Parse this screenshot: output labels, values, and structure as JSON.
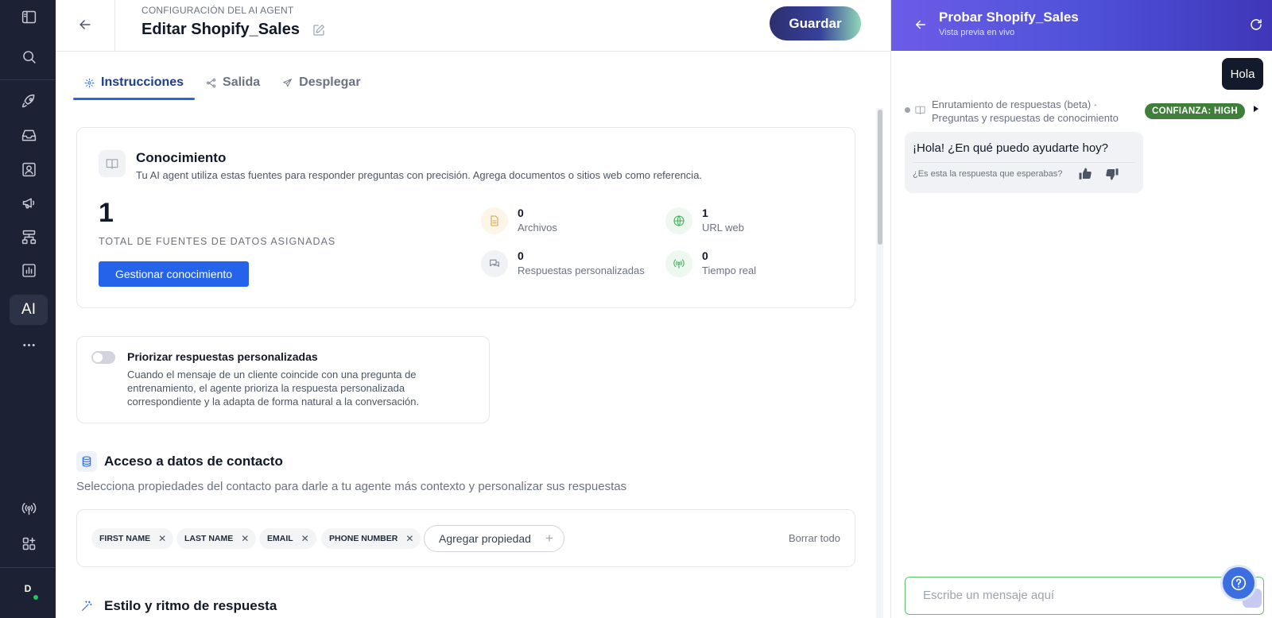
{
  "header": {
    "eyebrow": "CONFIGURACIÓN DEL AI AGENT",
    "title": "Editar Shopify_Sales",
    "save_label": "Guardar"
  },
  "rail": {
    "ai_label": "AI",
    "avatar_initial": "D"
  },
  "tabs": [
    {
      "label": "Instrucciones",
      "active": true
    },
    {
      "label": "Salida",
      "active": false
    },
    {
      "label": "Desplegar",
      "active": false
    }
  ],
  "knowledge": {
    "title": "Conocimiento",
    "description": "Tu AI agent utiliza estas fuentes para responder preguntas con precisión. Agrega documentos o sitios web como referencia.",
    "total": "1",
    "total_caption": "TOTAL DE FUENTES DE DATOS ASIGNADAS",
    "manage_label": "Gestionar conocimiento",
    "stats": [
      {
        "value": "0",
        "label": "Archivos",
        "icon": "document-icon",
        "color": "#d4a24c"
      },
      {
        "value": "1",
        "label": "URL web",
        "icon": "globe-icon",
        "color": "#3fae5a"
      },
      {
        "value": "0",
        "label": "Respuestas personalizadas",
        "icon": "chat-icon",
        "color": "#7c8596"
      },
      {
        "value": "0",
        "label": "Tiempo real",
        "icon": "broadcast-icon",
        "color": "#3fae5a"
      }
    ]
  },
  "prioritize": {
    "title": "Priorizar respuestas personalizadas",
    "description": "Cuando el mensaje de un cliente coincide con una pregunta de entrenamiento, el agente prioriza la respuesta personalizada correspondiente y la adapta de forma natural a la conversación.",
    "enabled": false
  },
  "contact_access": {
    "title": "Acceso a datos de contacto",
    "description": "Selecciona propiedades del contacto para darle a tu agente más contexto y personalizar sus respuestas",
    "properties": [
      "FIRST NAME",
      "LAST NAME",
      "EMAIL",
      "PHONE NUMBER"
    ],
    "add_label": "Agregar propiedad",
    "clear_label": "Borrar todo"
  },
  "style_section": {
    "title": "Estilo y ritmo de respuesta"
  },
  "preview": {
    "title": "Probar Shopify_Sales",
    "subtitle": "Vista previa en vivo",
    "user_message": "Hola",
    "routing_text": "Enrutamiento de respuestas (beta) · Preguntas y respuestas de conocimiento",
    "confidence": "CONFIANZA: HIGH",
    "bot_message": "¡Hola! ¿En qué puedo ayudarte hoy?",
    "feedback_question": "¿Es esta la respuesta que esperabas?",
    "composer_placeholder": "Escribe un mensaje aquí"
  },
  "colors": {
    "accent": "#2563eb",
    "rail_bg": "#1c2133",
    "confidence_badge": "#3f7f3a"
  }
}
